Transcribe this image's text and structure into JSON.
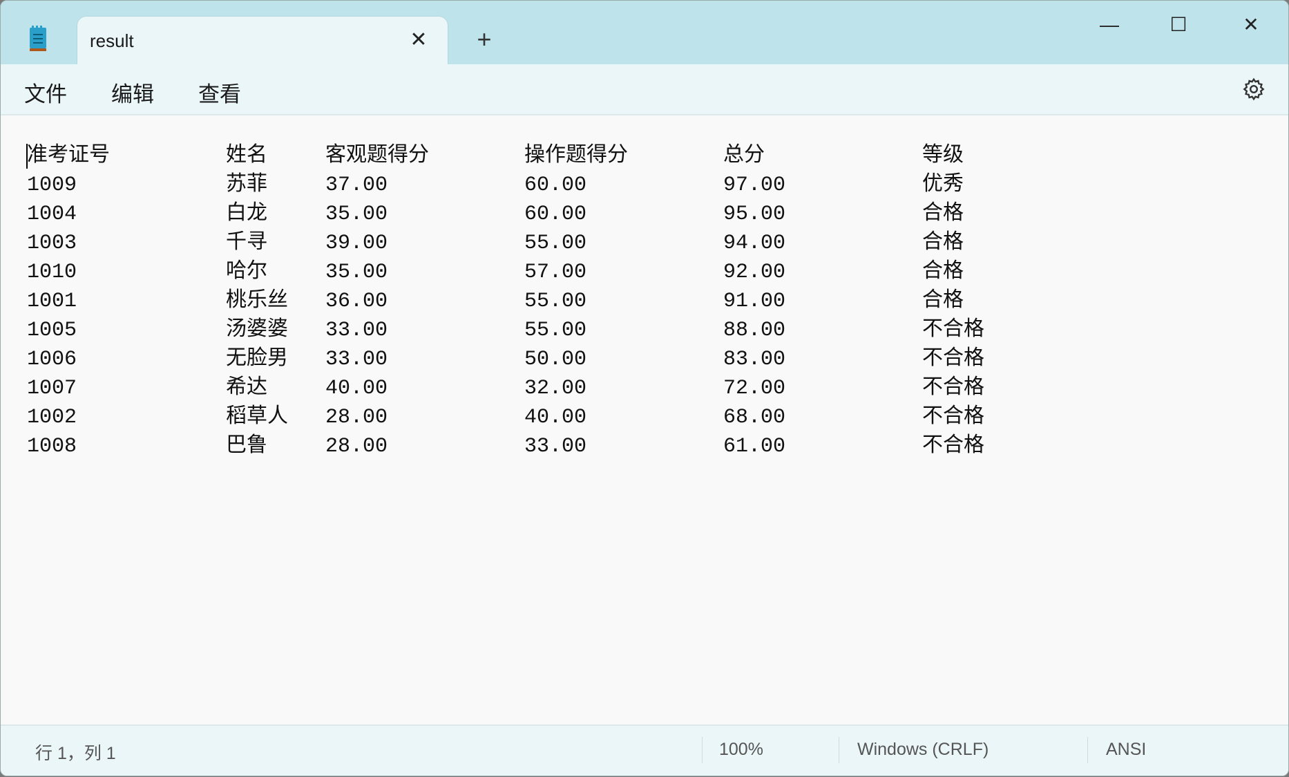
{
  "tab": {
    "title": "result"
  },
  "menu": [
    "文件",
    "编辑",
    "查看"
  ],
  "table": {
    "headers": [
      "准考证号",
      "姓名",
      "客观题得分",
      "操作题得分",
      "总分",
      "等级"
    ],
    "rows": [
      [
        "1009",
        "苏菲",
        "37.00",
        "60.00",
        "97.00",
        "优秀"
      ],
      [
        "1004",
        "白龙",
        "35.00",
        "60.00",
        "95.00",
        "合格"
      ],
      [
        "1003",
        "千寻",
        "39.00",
        "55.00",
        "94.00",
        "合格"
      ],
      [
        "1010",
        "哈尔",
        "35.00",
        "57.00",
        "92.00",
        "合格"
      ],
      [
        "1001",
        "桃乐丝",
        "36.00",
        "55.00",
        "91.00",
        "合格"
      ],
      [
        "1005",
        "汤婆婆",
        "33.00",
        "55.00",
        "88.00",
        "不合格"
      ],
      [
        "1006",
        "无脸男",
        "33.00",
        "50.00",
        "83.00",
        "不合格"
      ],
      [
        "1007",
        "希达",
        "40.00",
        "32.00",
        "72.00",
        "不合格"
      ],
      [
        "1002",
        "稻草人",
        "28.00",
        "40.00",
        "68.00",
        "不合格"
      ],
      [
        "1008",
        "巴鲁",
        "28.00",
        "33.00",
        "61.00",
        "不合格"
      ]
    ]
  },
  "status": {
    "position": "行 1，列 1",
    "zoom": "100%",
    "line_ending": "Windows (CRLF)",
    "encoding": "ANSI"
  }
}
